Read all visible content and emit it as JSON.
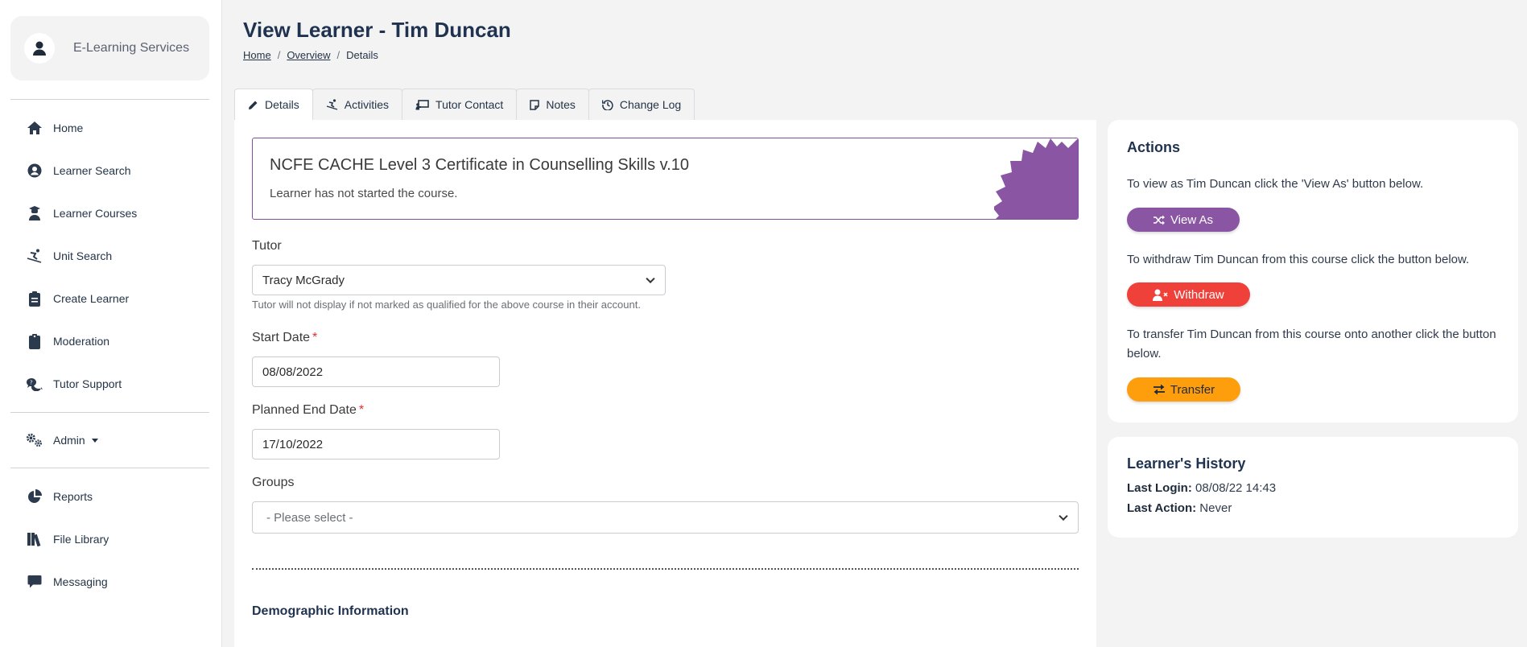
{
  "brand": {
    "name": "E-Learning Services"
  },
  "sidebar": {
    "items": [
      {
        "label": "Home",
        "icon": "home-icon"
      },
      {
        "label": "Learner Search",
        "icon": "user-circle-icon"
      },
      {
        "label": "Learner Courses",
        "icon": "graduate-icon"
      },
      {
        "label": "Unit Search",
        "icon": "skier-icon"
      },
      {
        "label": "Create Learner",
        "icon": "clipboard-list-icon"
      },
      {
        "label": "Moderation",
        "icon": "clipboard-icon"
      },
      {
        "label": "Tutor Support",
        "icon": "help-chat-icon"
      },
      {
        "label": "Admin",
        "icon": "gears-icon"
      },
      {
        "label": "Reports",
        "icon": "pie-chart-icon"
      },
      {
        "label": "File Library",
        "icon": "books-icon"
      },
      {
        "label": "Messaging",
        "icon": "message-icon"
      }
    ]
  },
  "header": {
    "title": "View Learner - Tim Duncan",
    "breadcrumb": {
      "home": "Home",
      "overview": "Overview",
      "current": "Details",
      "separator": "/"
    }
  },
  "tabs": [
    {
      "label": "Details",
      "icon": "pencil-icon",
      "active": true
    },
    {
      "label": "Activities",
      "icon": "skier-icon",
      "active": false
    },
    {
      "label": "Tutor Contact",
      "icon": "chalkboard-icon",
      "active": false
    },
    {
      "label": "Notes",
      "icon": "note-icon",
      "active": false
    },
    {
      "label": "Change Log",
      "icon": "history-icon",
      "active": false
    }
  ],
  "course": {
    "title": "NCFE CACHE Level 3 Certificate in Counselling Skills v.10",
    "status": "Learner has not started the course.",
    "color": "#8a55a3"
  },
  "form": {
    "tutor_label": "Tutor",
    "tutor_value": "Tracy McGrady",
    "tutor_help": "Tutor will not display if not marked as qualified for the above course in their account.",
    "start_label": "Start Date",
    "start_value": "08/08/2022",
    "end_label": "Planned End Date",
    "end_value": "17/10/2022",
    "required_mark": "*",
    "groups_label": "Groups",
    "groups_value": "- Please select -",
    "demographic_title": "Demographic Information"
  },
  "actions": {
    "title": "Actions",
    "view_as_text": "To view as Tim Duncan click the 'View As' button below.",
    "view_as_label": "View As",
    "withdraw_text": "To withdraw Tim Duncan from this course click the button below.",
    "withdraw_label": "Withdraw",
    "transfer_text": "To transfer Tim Duncan from this course onto another click the button below.",
    "transfer_label": "Transfer",
    "colors": {
      "view_as": "#8a55a3",
      "withdraw": "#f0403a",
      "transfer": "#ff9e0d"
    }
  },
  "history": {
    "title": "Learner's History",
    "last_login_label": "Last Login:",
    "last_login_value": "08/08/22 14:43",
    "last_action_label": "Last Action:",
    "last_action_value": "Never"
  }
}
